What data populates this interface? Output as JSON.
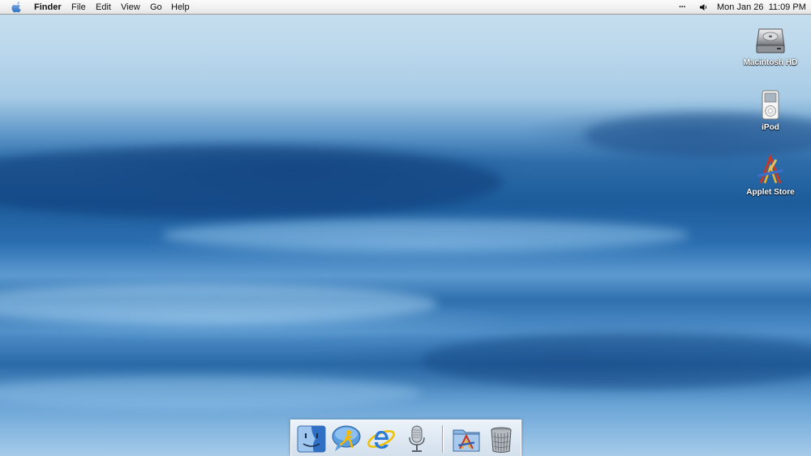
{
  "menubar": {
    "apple_icon": "apple-logo-icon",
    "app_name": "Finder",
    "menus": [
      "File",
      "Edit",
      "View",
      "Go",
      "Help"
    ],
    "status": {
      "overflow": "···",
      "volume_icon": "speaker-icon",
      "clock": "Mon Jan 26  11:09 PM"
    }
  },
  "desktop_icons": [
    {
      "label": "Macintosh HD",
      "icon": "hard-drive-icon"
    },
    {
      "label": "iPod",
      "icon": "ipod-icon"
    },
    {
      "label": "Applet Store",
      "icon": "applications-a-icon"
    }
  ],
  "dock": {
    "items": [
      {
        "name": "Finder",
        "icon": "finder-face-icon"
      },
      {
        "name": "iChat",
        "icon": "ichat-bubble-icon"
      },
      {
        "name": "Internet Explorer",
        "icon": "internet-explorer-icon"
      },
      {
        "name": "Speech",
        "icon": "microphone-icon"
      },
      {
        "name": "Applications",
        "icon": "applications-folder-icon"
      },
      {
        "name": "Trash",
        "icon": "trash-can-icon"
      }
    ]
  },
  "colors": {
    "menubar_bg": "#f1f1f1",
    "desktop_top": "#c9e0ef",
    "desktop_blue": "#1d5c9b",
    "label_text": "#ffffff"
  }
}
